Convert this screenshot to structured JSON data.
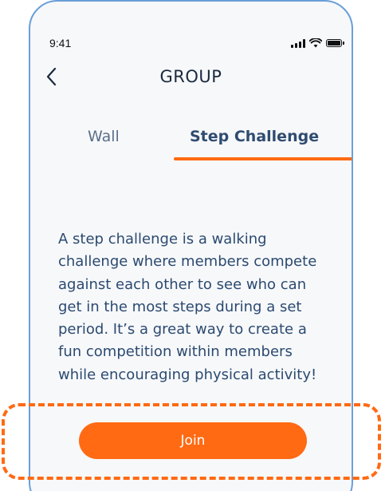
{
  "status_bar": {
    "time": "9:41"
  },
  "header": {
    "title": "GROUP",
    "back_icon": "chevron-left-icon"
  },
  "tabs": [
    {
      "label": "Wall",
      "active": false
    },
    {
      "label": "Step Challenge",
      "active": true
    }
  ],
  "content": {
    "description": "A step challenge is a walking challenge where members compete against each other to see who can get in the most steps during a set period. It’s a great way to create a fun competition within members while encouraging physical activity!"
  },
  "actions": {
    "join_label": "Join"
  },
  "colors": {
    "accent": "#ff6a13",
    "frame": "#6a9fd8",
    "text": "#2b4a70"
  }
}
